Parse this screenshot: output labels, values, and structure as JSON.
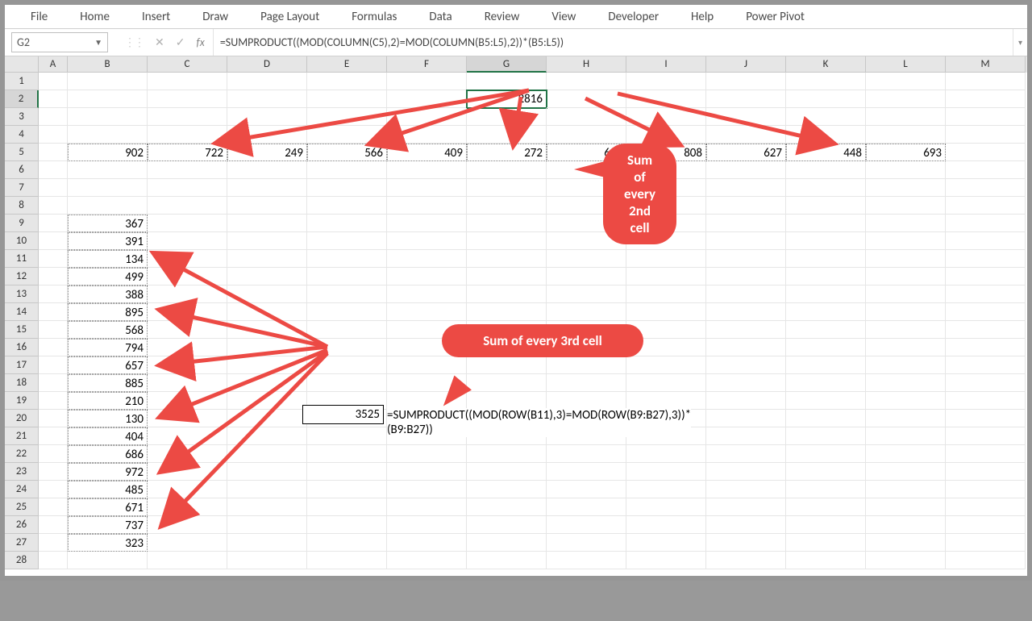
{
  "ribbon": [
    "File",
    "Home",
    "Insert",
    "Draw",
    "Page Layout",
    "Formulas",
    "Data",
    "Review",
    "View",
    "Developer",
    "Help",
    "Power Pivot"
  ],
  "namebox": "G2",
  "formula": "=SUMPRODUCT((MOD(COLUMN(C5),2)=MOD(COLUMN(B5:L5),2))*(B5:L5))",
  "colLetters": [
    "A",
    "B",
    "C",
    "D",
    "E",
    "F",
    "G",
    "H",
    "I",
    "J",
    "K",
    "L",
    "M"
  ],
  "activeCol": "G",
  "activeRow": 2,
  "g2": "2816",
  "row5": [
    "902",
    "722",
    "249",
    "566",
    "409",
    "272",
    "627",
    "808",
    "627",
    "448",
    "693"
  ],
  "colB": {
    "9": "367",
    "10": "391",
    "11": "134",
    "12": "499",
    "13": "388",
    "14": "895",
    "15": "568",
    "16": "794",
    "17": "657",
    "18": "885",
    "19": "210",
    "20": "130",
    "21": "404",
    "22": "686",
    "23": "972",
    "24": "485",
    "25": "671",
    "26": "737",
    "27": "323"
  },
  "e16": "3525",
  "e16_formula": "=SUMPRODUCT((MOD(ROW(B11),3)=MOD(ROW(B9:B27),3))*(B9:B27))",
  "callout1": "Sum of every 2nd cell",
  "callout2": "Sum of every 3rd cell",
  "fx": "fx",
  "chart_data": null
}
